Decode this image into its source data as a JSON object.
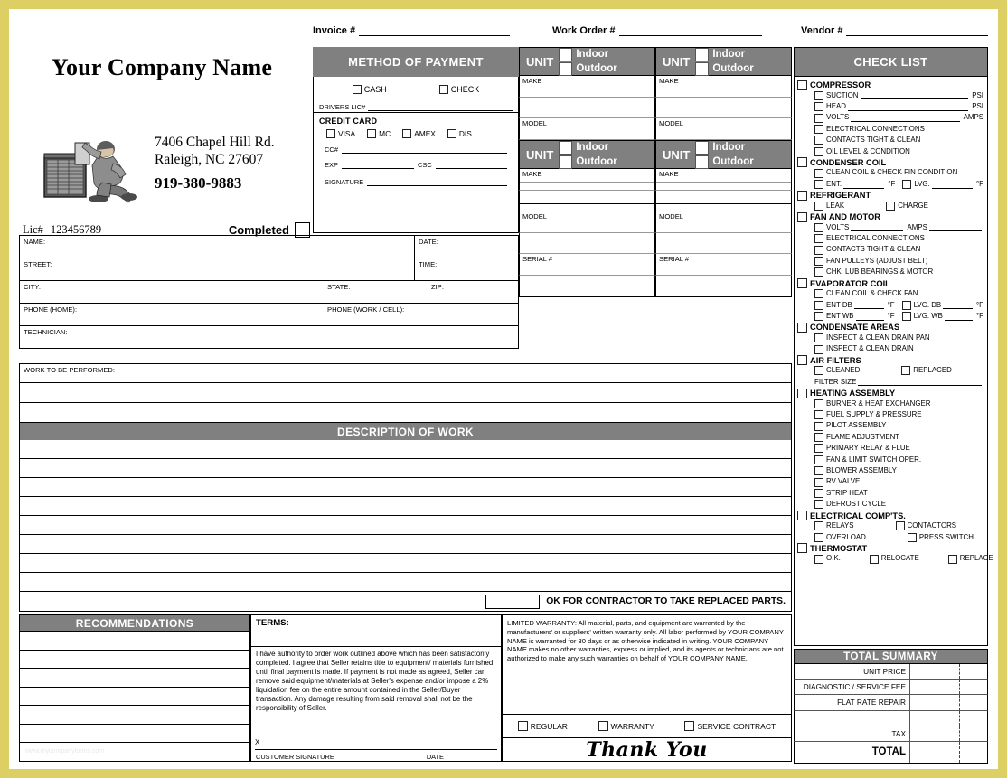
{
  "header": {
    "invoice_label": "Invoice #",
    "work_order_label": "Work Order #",
    "vendor_label": "Vendor #"
  },
  "company": {
    "name": "Your Company Name",
    "address_line1": "7406 Chapel Hill Rd.",
    "address_line2": "Raleigh, NC 27607",
    "phone": "919-380-9883",
    "license_label": "Lic#",
    "license_number": "123456789",
    "completed_label": "Completed"
  },
  "payment": {
    "title": "METHOD OF PAYMENT",
    "cash": "CASH",
    "check": "CHECK",
    "drivers_lic_label": "DRIVERS LIC#",
    "credit_card_label": "CREDIT CARD",
    "cards": [
      "VISA",
      "MC",
      "AMEX",
      "DIS"
    ],
    "cc_label": "CC#",
    "exp_label": "EXP",
    "csc_label": "CSC",
    "signature_label": "SIGNATURE"
  },
  "units": {
    "unit_label": "UNIT",
    "indoor": "Indoor",
    "outdoor": "Outdoor",
    "make": "MAKE",
    "model": "MODEL",
    "serial": "SERIAL #"
  },
  "customer": {
    "name": "NAME:",
    "street": "STREET:",
    "city": "CITY:",
    "state": "STATE:",
    "zip": "ZIP:",
    "phone_home": "PHONE (HOME):",
    "phone_work": "PHONE (WORK / CELL):",
    "technician": "TECHNICIAN:",
    "date": "DATE:",
    "time": "TIME:"
  },
  "work": {
    "to_be_performed": "WORK TO BE PERFORMED:",
    "description_title": "DESCRIPTION OF WORK",
    "ok_parts": "OK FOR CONTRACTOR TO TAKE REPLACED PARTS."
  },
  "recommendations": {
    "title": "RECOMMENDATIONS",
    "watermark": "www.mycompanyforms.com"
  },
  "terms": {
    "title": "TERMS:",
    "body": "I have authority to order work outlined above which has been satisfactorily completed. I agree that Seller retains title to equipment/ materials furnished until final payment is made.  If payment is not made as agreed, Seller can remove said equipment/materials at Seller's expense and/or impose a 2% liquidation fee on the entire amount contained in the Seller/Buyer transaction. Any damage resulting from said removal shall not be the responsibility of Seller.",
    "signature_x": "X",
    "signature_caption": "CUSTOMER SIGNATURE",
    "date_caption": "DATE"
  },
  "warranty": {
    "body": "LIMITED WARRANTY:  All material, parts, and equipment are warranted by the manufacturers' or suppliers' written warranty only.  All labor performed by YOUR COMPANY NAME is warranted for 30 days or as otherwise indicated in writing. YOUR COMPANY NAME makes no other warranties, express or implied, and its agents or technicians are not authorized to make any such warranties on behalf of YOUR COMPANY NAME.",
    "types": [
      "REGULAR",
      "WARRANTY",
      "SERVICE CONTRACT"
    ],
    "thank_you": "Thank You"
  },
  "checklist": {
    "title": "CHECK LIST",
    "groups": [
      {
        "name": "COMPRESSOR",
        "items": [
          {
            "label": "SUCTION",
            "line": true,
            "unit": "PSI"
          },
          {
            "label": "HEAD",
            "line": true,
            "unit": "PSI"
          },
          {
            "label": "VOLTS",
            "line": true,
            "unit": "AMPS"
          },
          {
            "label": "ELECTRICAL CONNECTIONS"
          },
          {
            "label": "CONTACTS TIGHT & CLEAN"
          },
          {
            "label": "OIL LEVEL & CONDITION"
          }
        ]
      },
      {
        "name": "CONDENSER COIL",
        "items": [
          {
            "label": "CLEAN COIL & CHECK FIN CONDITION"
          },
          {
            "label": "ENT.",
            "line": true,
            "unit": "°F",
            "label2": "LVG.",
            "unit2": "°F"
          }
        ]
      },
      {
        "name": "REFRIGERANT",
        "items": [
          {
            "label": "LEAK",
            "label2": "CHARGE"
          }
        ]
      },
      {
        "name": "FAN AND MOTOR",
        "items": [
          {
            "label": "VOLTS",
            "line": true,
            "unit": "AMPS",
            "trailing_line": true
          },
          {
            "label": "ELECTRICAL CONNECTIONS"
          },
          {
            "label": "CONTACTS TIGHT & CLEAN"
          },
          {
            "label": "FAN PULLEYS (ADJUST BELT)"
          },
          {
            "label": "CHK. LUB BEARINGS & MOTOR"
          }
        ]
      },
      {
        "name": "EVAPORATOR COIL",
        "items": [
          {
            "label": "CLEAN COIL & CHECK FAN"
          },
          {
            "label": "ENT DB",
            "line": true,
            "unit": "°F",
            "label2": "LVG. DB",
            "unit2": "°F"
          },
          {
            "label": "ENT WB",
            "line": true,
            "unit": "°F",
            "label2": "LVG. WB",
            "unit2": "°F"
          }
        ]
      },
      {
        "name": "CONDENSATE AREAS",
        "items": [
          {
            "label": "INSPECT & CLEAN DRAIN PAN"
          },
          {
            "label": "INSPECT & CLEAN DRAIN"
          }
        ]
      },
      {
        "name": "AIR FILTERS",
        "items": [
          {
            "label": "CLEANED",
            "label2": "REPLACED"
          },
          {
            "label": "FILTER SIZE",
            "line": true,
            "nocheck": true
          }
        ]
      },
      {
        "name": "HEATING ASSEMBLY",
        "items": [
          {
            "label": "BURNER & HEAT EXCHANGER"
          },
          {
            "label": "FUEL SUPPLY & PRESSURE"
          },
          {
            "label": "PILOT ASSEMBLY"
          },
          {
            "label": "FLAME ADJUSTMENT"
          },
          {
            "label": "PRIMARY RELAY & FLUE"
          },
          {
            "label": "FAN & LIMIT SWITCH OPER."
          },
          {
            "label": "BLOWER ASSEMBLY"
          },
          {
            "label": "RV VALVE"
          },
          {
            "label": "STRIP HEAT"
          },
          {
            "label": "DEFROST CYCLE"
          }
        ]
      },
      {
        "name": "ELECTRICAL COMP'TS.",
        "items": [
          {
            "label": "RELAYS",
            "label2": "CONTACTORS"
          },
          {
            "label": "OVERLOAD",
            "label2": "PRESS SWITCH"
          }
        ]
      },
      {
        "name": "THERMOSTAT",
        "items": [
          {
            "label": "O.K.",
            "label2": "RELOCATE",
            "label3": "REPLACE"
          }
        ]
      }
    ]
  },
  "total_summary": {
    "title": "TOTAL SUMMARY",
    "rows": [
      "UNIT PRICE",
      "DIAGNOSTIC / SERVICE FEE",
      "FLAT RATE REPAIR",
      "",
      "TAX"
    ],
    "total_label": "TOTAL"
  },
  "colors": {
    "header_gray": "#808080",
    "page_border": "#ddcf63",
    "ink": "#000000"
  }
}
